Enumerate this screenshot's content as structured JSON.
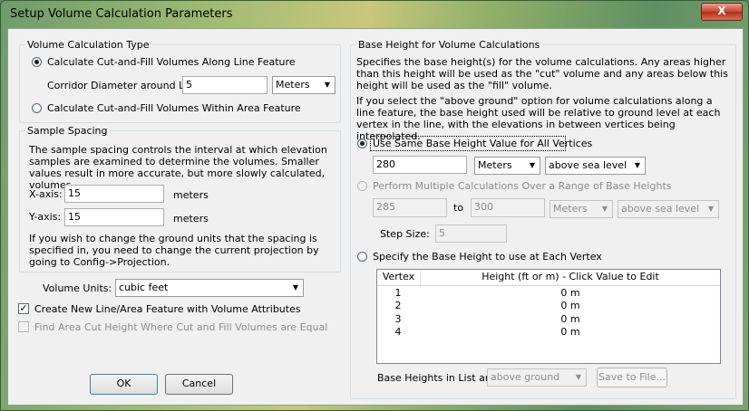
{
  "window": {
    "title": "Setup Volume Calculation Parameters",
    "close_label": "X"
  },
  "volume_type": {
    "title": "Volume Calculation Type",
    "option_line": "Calculate Cut-and-Fill Volumes Along Line Feature",
    "corridor_label": "Corridor Diameter around Line:",
    "corridor_value": "5",
    "corridor_units": "Meters",
    "option_area": "Calculate Cut-and-Fill Volumes Within Area Feature"
  },
  "sample_spacing": {
    "title": "Sample Spacing",
    "description": "The sample spacing controls the interval at which elevation samples are examined to determine the volumes. Smaller values result in more accurate, but more slowly calculated, volumes.",
    "x_label": "X-axis:",
    "x_value": "15",
    "x_units": "meters",
    "y_label": "Y-axis:",
    "y_value": "15",
    "y_units": "meters",
    "note": "If you wish to change the ground units that the spacing is specified in, you need to change the current projection by going to Config->Projection."
  },
  "volume_units": {
    "label": "Volume Units:",
    "value": "cubic feet"
  },
  "options": {
    "create_feature": "Create New Line/Area Feature with Volume Attributes",
    "find_height": "Find Area Cut Height Where Cut and Fill Volumes are Equal"
  },
  "buttons": {
    "ok": "OK",
    "cancel": "Cancel"
  },
  "base_height": {
    "title": "Base Height for Volume Calculations",
    "desc1": "Specifies the base height(s) for the volume calculations. Any areas higher than this height will be used as the \"cut\" volume and any areas below this height will be used as the \"fill\" volume.",
    "desc2": "If you select the \"above ground\" option for volume calculations along a line feature, the base height used will be relative to ground level at each vertex in the line, with the elevations in between vertices being interpolated.",
    "opt_same": "Use Same Base Height Value for All Vertices",
    "same_value": "280",
    "same_units": "Meters",
    "same_ref": "above sea level",
    "opt_multiple": "Perform Multiple Calculations Over a Range of Base Heights",
    "range_from": "285",
    "range_to_label": "to",
    "range_to": "300",
    "range_units": "Meters",
    "range_ref": "above sea level",
    "step_label": "Step Size:",
    "step_value": "5",
    "opt_each": "Specify the Base Height to use at Each Vertex",
    "table": {
      "headers": [
        "Vertex",
        "Height (ft or m) - Click Value to Edit"
      ],
      "rows": [
        {
          "vertex": "1",
          "height": "0 m"
        },
        {
          "vertex": "2",
          "height": "0 m"
        },
        {
          "vertex": "3",
          "height": "0 m"
        },
        {
          "vertex": "4",
          "height": "0 m"
        }
      ]
    },
    "list_label": "Base Heights in List are",
    "list_ref": "above ground",
    "save_button": "Save to File..."
  }
}
